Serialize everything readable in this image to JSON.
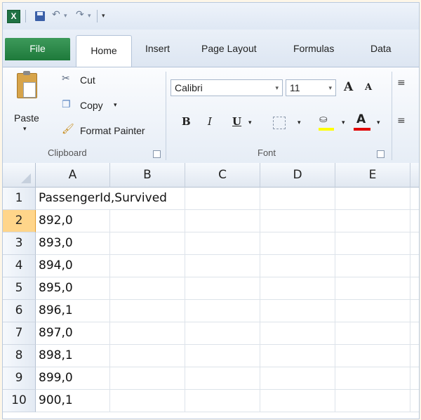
{
  "qat": {
    "app_icon": "excel-icon",
    "save_icon": "save-icon",
    "undo_icon": "undo-icon",
    "redo_icon": "redo-icon",
    "customize_icon": "customize-dropdown-icon"
  },
  "tabs": [
    "File",
    "Home",
    "Insert",
    "Page Layout",
    "Formulas",
    "Data"
  ],
  "ribbon": {
    "clipboard": {
      "paste": "Paste",
      "cut": "Cut",
      "copy": "Copy",
      "format_painter": "Format Painter",
      "group_label": "Clipboard"
    },
    "font": {
      "font_name": "Calibri",
      "font_size": "11",
      "group_label": "Font",
      "bold": "B",
      "italic": "I",
      "underline": "U",
      "grow": "A",
      "shrink": "A",
      "font_color": "A",
      "fill_color_hex": "#ffff00",
      "font_color_hex": "#e00000"
    }
  },
  "sheet": {
    "columns": [
      "A",
      "B",
      "C",
      "D",
      "E"
    ],
    "rows": [
      {
        "num": "1",
        "a": "PassengerId,Survived"
      },
      {
        "num": "2",
        "a": "892,0"
      },
      {
        "num": "3",
        "a": "893,0"
      },
      {
        "num": "4",
        "a": "894,0"
      },
      {
        "num": "5",
        "a": "895,0"
      },
      {
        "num": "6",
        "a": "896,1"
      },
      {
        "num": "7",
        "a": "897,0"
      },
      {
        "num": "8",
        "a": "898,1"
      },
      {
        "num": "9",
        "a": "899,0"
      },
      {
        "num": "10",
        "a": "900,1"
      }
    ],
    "selected_row": "2"
  }
}
